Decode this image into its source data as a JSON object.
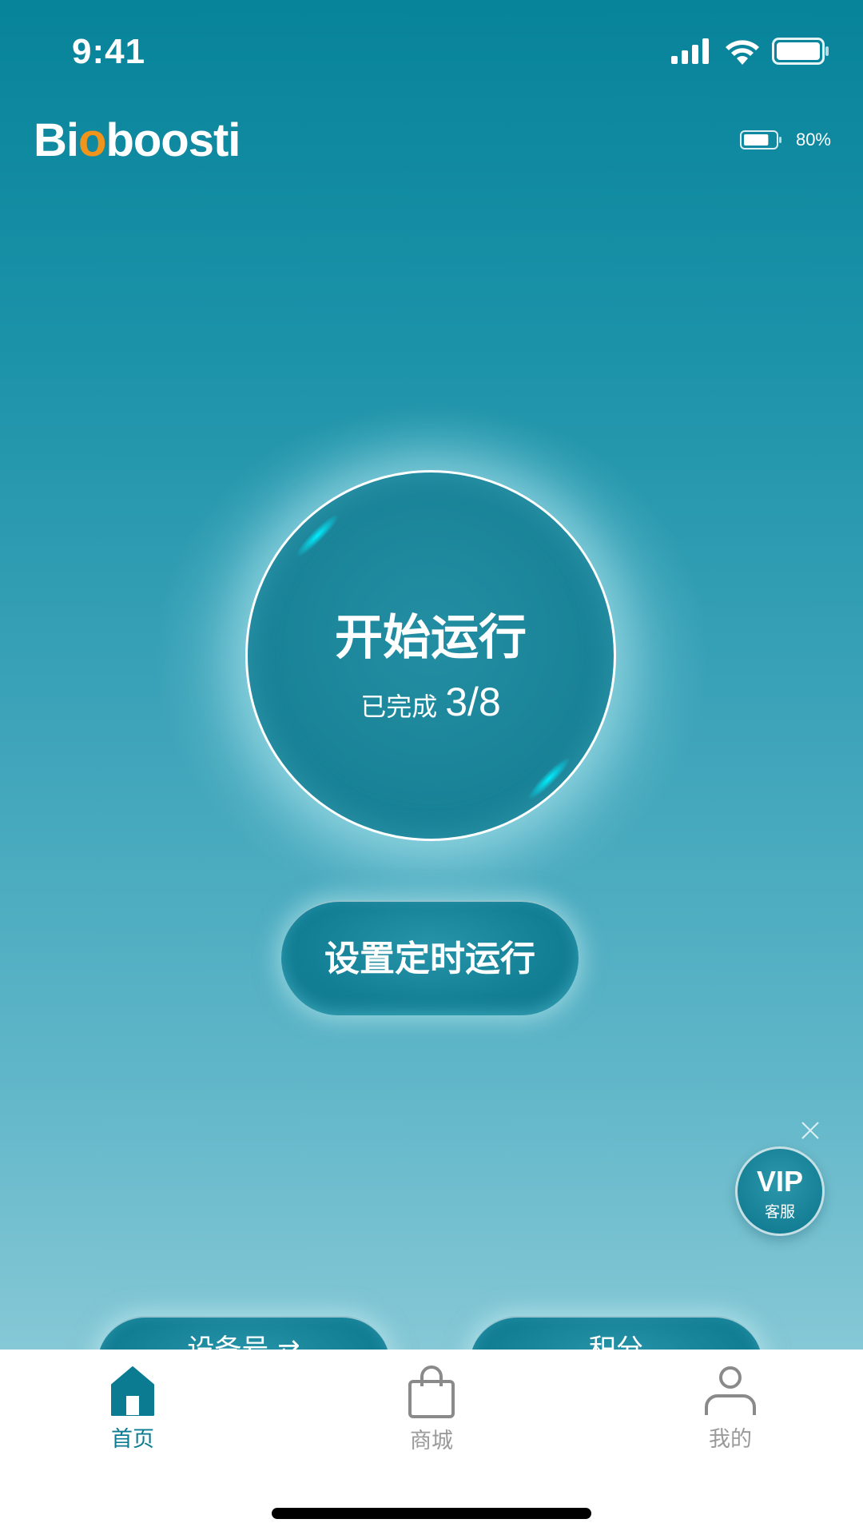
{
  "status_bar": {
    "time": "9:41",
    "icons": [
      "signal-icon",
      "wifi-icon",
      "battery-icon"
    ]
  },
  "header": {
    "brand_prefix": "Bi",
    "brand_accent": "o",
    "brand_suffix": "boosti",
    "device_battery": "80%",
    "device_battery_level": 0.8
  },
  "main": {
    "start_label": "开始运行",
    "progress_label": "已完成",
    "progress_value": "3/8",
    "schedule_label": "设置定时运行"
  },
  "bottom_pills": {
    "device_label": "设备号 ⇄",
    "points_label": "积分"
  },
  "vip": {
    "title": "VIP",
    "subtitle": "客服",
    "close_icon": "close-icon"
  },
  "tabs": [
    {
      "label": "首页",
      "icon": "home-icon",
      "active": true
    },
    {
      "label": "商城",
      "icon": "shopping-bag-icon",
      "active": false
    },
    {
      "label": "我的",
      "icon": "user-icon",
      "active": false
    }
  ],
  "colors": {
    "brand_accent": "#f0941b",
    "tab_active": "#0b7b92",
    "tab_inactive": "#9a9a9a",
    "primary_teal": "#137f95"
  }
}
